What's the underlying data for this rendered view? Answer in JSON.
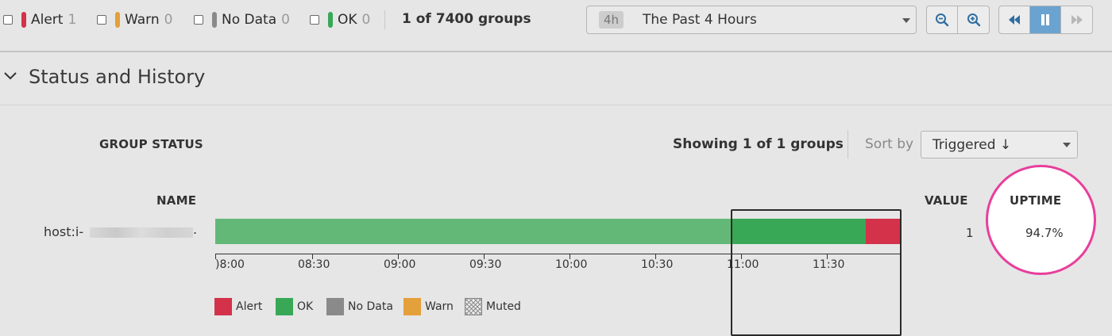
{
  "filters": [
    {
      "label": "Alert",
      "count": "1",
      "color": "#d3324a"
    },
    {
      "label": "Warn",
      "count": "0",
      "color": "#e4a03a"
    },
    {
      "label": "No Data",
      "count": "0",
      "color": "#8a8a8a"
    },
    {
      "label": "OK",
      "count": "0",
      "color": "#39a856"
    }
  ],
  "groups_count": "1 of 7400 groups",
  "time_selector": {
    "badge": "4h",
    "label": "The Past 4 Hours"
  },
  "icons": {
    "zoom_out": "zoom-out-icon",
    "zoom_in": "zoom-in-icon",
    "rewind": "rewind-icon",
    "pause": "pause-icon",
    "fast_forward": "fast-forward-icon"
  },
  "section": {
    "title": "Status and History",
    "icon": "chevron-down-icon"
  },
  "group_status": {
    "heading": "GROUP STATUS",
    "showing": "Showing 1 of 1 groups",
    "sort_label": "Sort by",
    "sort_value": "Triggered ↓"
  },
  "table": {
    "name_header": "NAME",
    "value_header": "VALUE",
    "uptime_header": "UPTIME",
    "rows": [
      {
        "name": "host:i-",
        "name_suffix": ".",
        "value": "1",
        "uptime": "94.7%"
      }
    ]
  },
  "timeline": {
    "ticks": [
      ")8:00",
      "08:30",
      "09:00",
      "09:30",
      "10:00",
      "10:30",
      "11:00",
      "11:30"
    ],
    "segments": [
      {
        "state": "OK",
        "from": "07:59",
        "to": "10:59",
        "color": "#63b878"
      },
      {
        "state": "OK",
        "from": "10:59",
        "to": "11:46",
        "color": "#39a856"
      },
      {
        "state": "Alert",
        "from": "11:46",
        "to": "11:58",
        "color": "#d3324a"
      }
    ]
  },
  "legend": [
    {
      "label": "Alert",
      "color": "#d3324a"
    },
    {
      "label": "OK",
      "color": "#39a856"
    },
    {
      "label": "No Data",
      "color": "#8a8a8a"
    },
    {
      "label": "Warn",
      "color": "#e4a03a"
    },
    {
      "label": "Muted",
      "color": "#999999"
    }
  ],
  "highlight_color": "#e83e9c"
}
